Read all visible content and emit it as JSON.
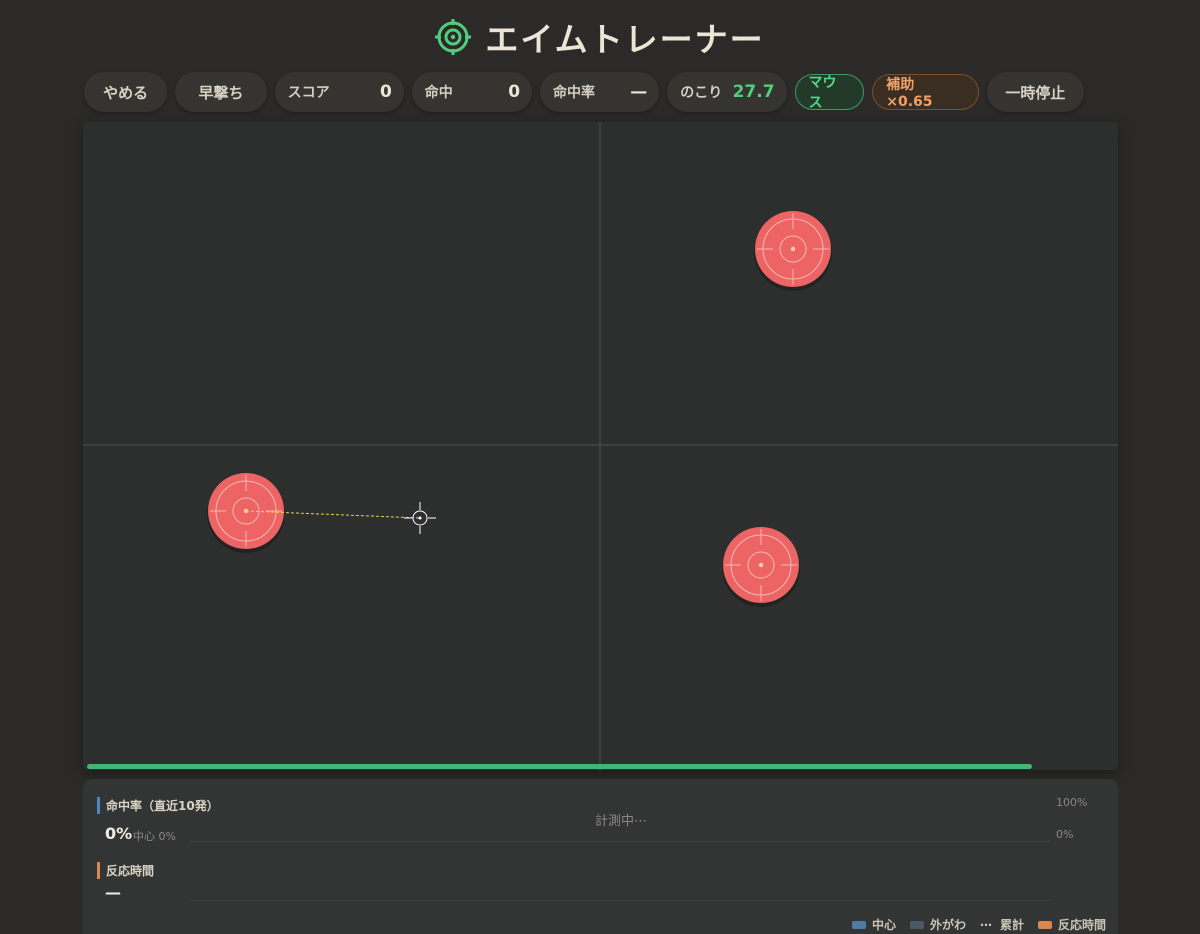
{
  "header": {
    "title": "エイムトレーナー",
    "icon": "target-icon",
    "accent": "#4fcf7d"
  },
  "toolbar": {
    "quit_label": "やめる",
    "quickdraw_label": "早撃ち",
    "score": {
      "label": "スコア",
      "value": "0"
    },
    "hits": {
      "label": "命中",
      "value": "0"
    },
    "accuracy": {
      "label": "命中率",
      "value": "—"
    },
    "remaining": {
      "label": "のこり",
      "value": "27.7"
    },
    "input_badge": "マウス",
    "assist_badge": "補助 ×0.65",
    "pause_label": "一時停止"
  },
  "arena": {
    "target_color": "#ec6463",
    "targets": [
      {
        "name": "target-1"
      },
      {
        "name": "target-2"
      },
      {
        "name": "target-3"
      }
    ],
    "round_progress": 0.92
  },
  "stats": {
    "accuracy_section": {
      "title": "命中率（直近10発）",
      "value": "0%",
      "center_label": "中心 0%",
      "status": "計測中⋯",
      "axis_top": "100%",
      "axis_bottom": "0%"
    },
    "reaction_section": {
      "title": "反応時間",
      "value": "—"
    },
    "legend": [
      {
        "label": "中心",
        "color": "#4e7aa6"
      },
      {
        "label": "外がわ",
        "color": "#4a5a66"
      },
      {
        "label": "累計",
        "color": "#c9c3b6"
      },
      {
        "label": "反応時間",
        "color": "#d9874e"
      }
    ]
  }
}
